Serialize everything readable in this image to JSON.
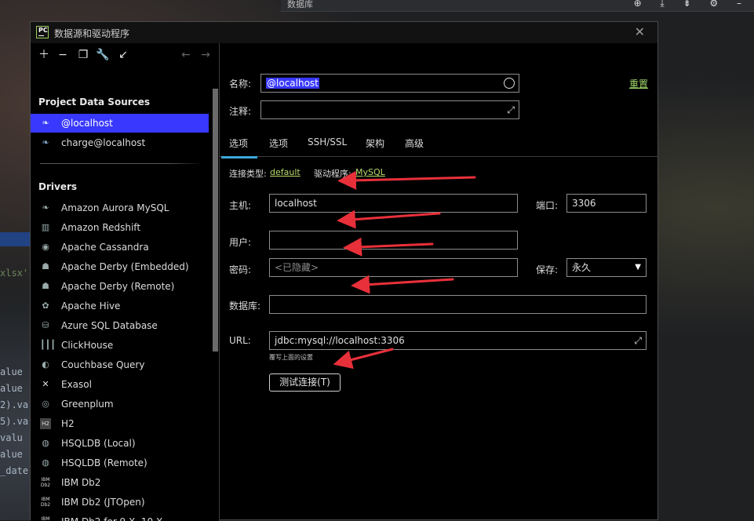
{
  "background": {
    "header_title": "数据库",
    "code_lines": [
      "alue",
      "alue",
      "2).va",
      "5).va",
      "valu",
      "alue",
      "_date"
    ],
    "code_fragment": "xlsx'"
  },
  "window": {
    "title": "数据源和驱动程序",
    "app_icon_text": "PC"
  },
  "left_panel": {
    "toolbar": [
      "add",
      "remove",
      "duplicate",
      "settings",
      "import",
      "back",
      "forward"
    ],
    "project_section_title": "Project Data Sources",
    "data_sources": [
      {
        "label": "@localhost",
        "icon": "mysql-icon",
        "selected": true
      },
      {
        "label": "charge@localhost",
        "icon": "mysql-icon",
        "selected": false
      }
    ],
    "drivers_section_title": "Drivers",
    "drivers": [
      {
        "label": "Amazon Aurora MySQL",
        "icon": "mysql-icon"
      },
      {
        "label": "Amazon Redshift",
        "icon": "redshift-icon"
      },
      {
        "label": "Apache Cassandra",
        "icon": "cassandra-icon"
      },
      {
        "label": "Apache Derby (Embedded)",
        "icon": "derby-icon"
      },
      {
        "label": "Apache Derby (Remote)",
        "icon": "derby-icon"
      },
      {
        "label": "Apache Hive",
        "icon": "hive-icon"
      },
      {
        "label": "Azure SQL Database",
        "icon": "azure-icon"
      },
      {
        "label": "ClickHouse",
        "icon": "clickhouse-icon"
      },
      {
        "label": "Couchbase Query",
        "icon": "couchbase-icon"
      },
      {
        "label": "Exasol",
        "icon": "exasol-icon"
      },
      {
        "label": "Greenplum",
        "icon": "greenplum-icon"
      },
      {
        "label": "H2",
        "icon": "h2-icon"
      },
      {
        "label": "HSQLDB (Local)",
        "icon": "hsqldb-icon"
      },
      {
        "label": "HSQLDB (Remote)",
        "icon": "hsqldb-icon"
      },
      {
        "label": "IBM Db2",
        "icon": "db2-icon"
      },
      {
        "label": "IBM Db2 (JTOpen)",
        "icon": "db2-icon"
      },
      {
        "label": "IBM Db2 for 9.X, 10.X",
        "icon": "db2-icon"
      }
    ]
  },
  "form": {
    "name_label": "名称:",
    "name_value": "@localhost",
    "comment_label": "注释:",
    "comment_value": "",
    "reset_label": "重置",
    "tabs": [
      {
        "label": "选项",
        "active": true
      },
      {
        "label": "选项",
        "active": false
      },
      {
        "label": "SSH/SSL",
        "active": false
      },
      {
        "label": "架构",
        "active": false
      },
      {
        "label": "高级",
        "active": false
      }
    ],
    "conn_type_label": "连接类型:",
    "conn_type_value": "default",
    "driver_label": "驱动程序:",
    "driver_value": "MySQL",
    "host_label": "主机:",
    "host_value": "localhost",
    "port_label": "端口:",
    "port_value": "3306",
    "user_label": "用户:",
    "user_value": "",
    "password_label": "密码:",
    "password_placeholder": "<已隐藏>",
    "save_label": "保存:",
    "save_value": "永久",
    "database_label": "数据库:",
    "database_value": "",
    "url_label": "URL:",
    "url_value": "jdbc:mysql://localhost:3306",
    "url_hint": "覆写上面的设置",
    "test_button": "测试连接(T)"
  },
  "colors": {
    "selection": "#3838ff",
    "link_green": "#9fd66b",
    "info_value": "#b7d86b",
    "annotation_arrow": "#e8303a",
    "tab_underline": "#3aa7d8"
  }
}
